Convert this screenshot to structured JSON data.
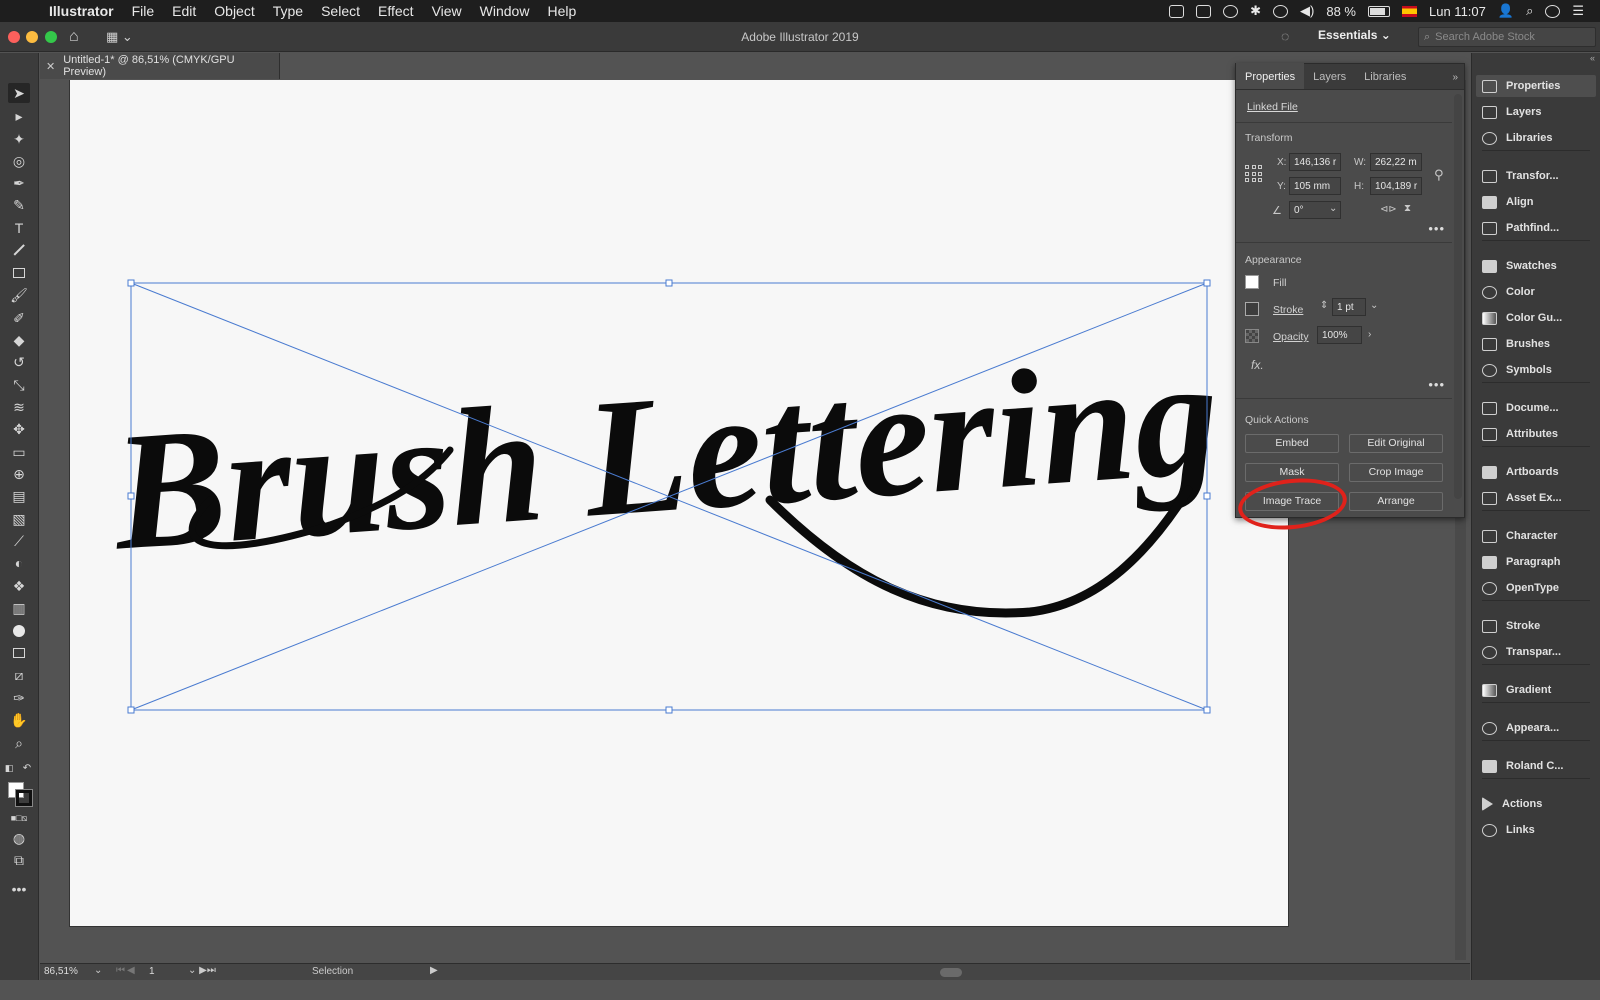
{
  "menubar": {
    "app_name": "Illustrator",
    "menus": [
      "File",
      "Edit",
      "Object",
      "Type",
      "Select",
      "Effect",
      "View",
      "Window",
      "Help"
    ],
    "battery": "88 %",
    "clock": "Lun 11:07"
  },
  "titlebar": {
    "title": "Adobe Illustrator 2019",
    "workspace": "Essentials",
    "search_placeholder": "Search Adobe Stock"
  },
  "document": {
    "tab_title": "Untitled-1* @ 86,51% (CMYK/GPU Preview)",
    "artwork_text": "Brush Lettering"
  },
  "statusbar": {
    "zoom": "86,51%",
    "page": "1",
    "tool_status": "Selection"
  },
  "properties": {
    "tabs": [
      "Properties",
      "Layers",
      "Libraries"
    ],
    "active_tab": "Properties",
    "linked_file": "Linked File",
    "transform": {
      "title": "Transform",
      "x_label": "X:",
      "x": "146,136 r",
      "y_label": "Y:",
      "y": "105 mm",
      "w_label": "W:",
      "w": "262,22 m",
      "h_label": "H:",
      "h": "104,189 r",
      "angle": "0°"
    },
    "appearance": {
      "title": "Appearance",
      "fill_label": "Fill",
      "stroke_label": "Stroke",
      "stroke_weight": "1 pt",
      "opacity_label": "Opacity",
      "opacity_value": "100%",
      "fx_label": "fx."
    },
    "quick_actions": {
      "title": "Quick Actions",
      "embed": "Embed",
      "edit_original": "Edit Original",
      "mask": "Mask",
      "crop_image": "Crop Image",
      "image_trace": "Image Trace",
      "arrange": "Arrange"
    }
  },
  "dock": {
    "items": [
      {
        "label": "Properties",
        "icon": "properties-icon"
      },
      {
        "label": "Layers",
        "icon": "layers-icon"
      },
      {
        "label": "Libraries",
        "icon": "libraries-icon"
      },
      {
        "label": "Transfor...",
        "icon": "transform-icon"
      },
      {
        "label": "Align",
        "icon": "align-icon"
      },
      {
        "label": "Pathfind...",
        "icon": "pathfinder-icon"
      },
      {
        "label": "Swatches",
        "icon": "swatches-icon"
      },
      {
        "label": "Color",
        "icon": "color-icon"
      },
      {
        "label": "Color Gu...",
        "icon": "color-guide-icon"
      },
      {
        "label": "Brushes",
        "icon": "brushes-icon"
      },
      {
        "label": "Symbols",
        "icon": "symbols-icon"
      },
      {
        "label": "Docume...",
        "icon": "document-info-icon"
      },
      {
        "label": "Attributes",
        "icon": "attributes-icon"
      },
      {
        "label": "Artboards",
        "icon": "artboards-icon"
      },
      {
        "label": "Asset Ex...",
        "icon": "asset-export-icon"
      },
      {
        "label": "Character",
        "icon": "character-icon"
      },
      {
        "label": "Paragraph",
        "icon": "paragraph-icon"
      },
      {
        "label": "OpenType",
        "icon": "opentype-icon"
      },
      {
        "label": "Stroke",
        "icon": "stroke-icon"
      },
      {
        "label": "Transpar...",
        "icon": "transparency-icon"
      },
      {
        "label": "Gradient",
        "icon": "gradient-icon"
      },
      {
        "label": "Appeara...",
        "icon": "appearance-icon"
      },
      {
        "label": "Roland C...",
        "icon": "roland-cutstudio-icon"
      },
      {
        "label": "Actions",
        "icon": "actions-icon"
      },
      {
        "label": "Links",
        "icon": "links-icon"
      }
    ]
  },
  "colors": {
    "highlight": "#e0221b",
    "selection": "#4a7bd0",
    "fill_swatch": "#ffffff",
    "stroke_swatch": "#111111"
  }
}
